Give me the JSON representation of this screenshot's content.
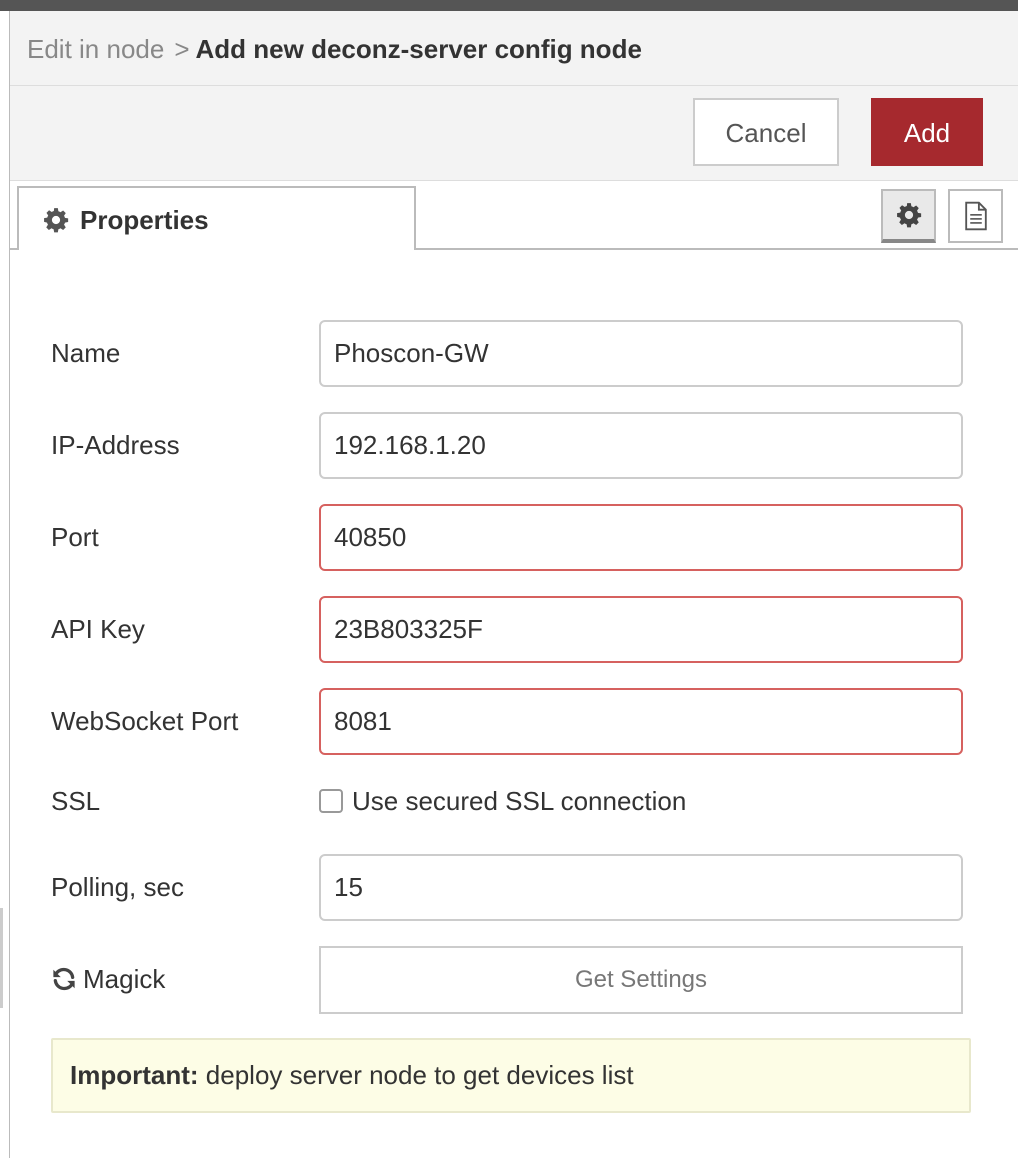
{
  "breadcrumb": {
    "parent": "Edit in node",
    "separator": ">",
    "current": "Add new deconz-server config node"
  },
  "toolbar": {
    "cancel_label": "Cancel",
    "add_label": "Add",
    "add_color": "#a6292e"
  },
  "tabs": {
    "active_label": "Properties",
    "active_icon": "gear-icon",
    "buttons": [
      {
        "icon": "gear-icon",
        "selected": true
      },
      {
        "icon": "document-icon",
        "selected": false
      }
    ]
  },
  "form": {
    "name": {
      "label": "Name",
      "value": "Phoscon-GW"
    },
    "ip": {
      "label": "IP-Address",
      "value": "192.168.1.20"
    },
    "port": {
      "label": "Port",
      "value": "40850",
      "invalid": true
    },
    "api_key": {
      "label": "API Key",
      "value": "23B803325F",
      "invalid": true
    },
    "ws_port": {
      "label": "WebSocket Port",
      "value": "8081",
      "invalid": true
    },
    "ssl": {
      "label": "SSL",
      "checkbox_label": "Use secured SSL connection",
      "checked": false
    },
    "polling": {
      "label": "Polling, sec",
      "value": "15"
    },
    "magick": {
      "label": "Magick",
      "icon": "refresh-icon",
      "button_label": "Get Settings"
    }
  },
  "notice": {
    "strong": "Important:",
    "text": "deploy server node to get devices list"
  },
  "colors": {
    "invalid_border": "#d6615f",
    "notice_bg": "#fdfde6"
  }
}
